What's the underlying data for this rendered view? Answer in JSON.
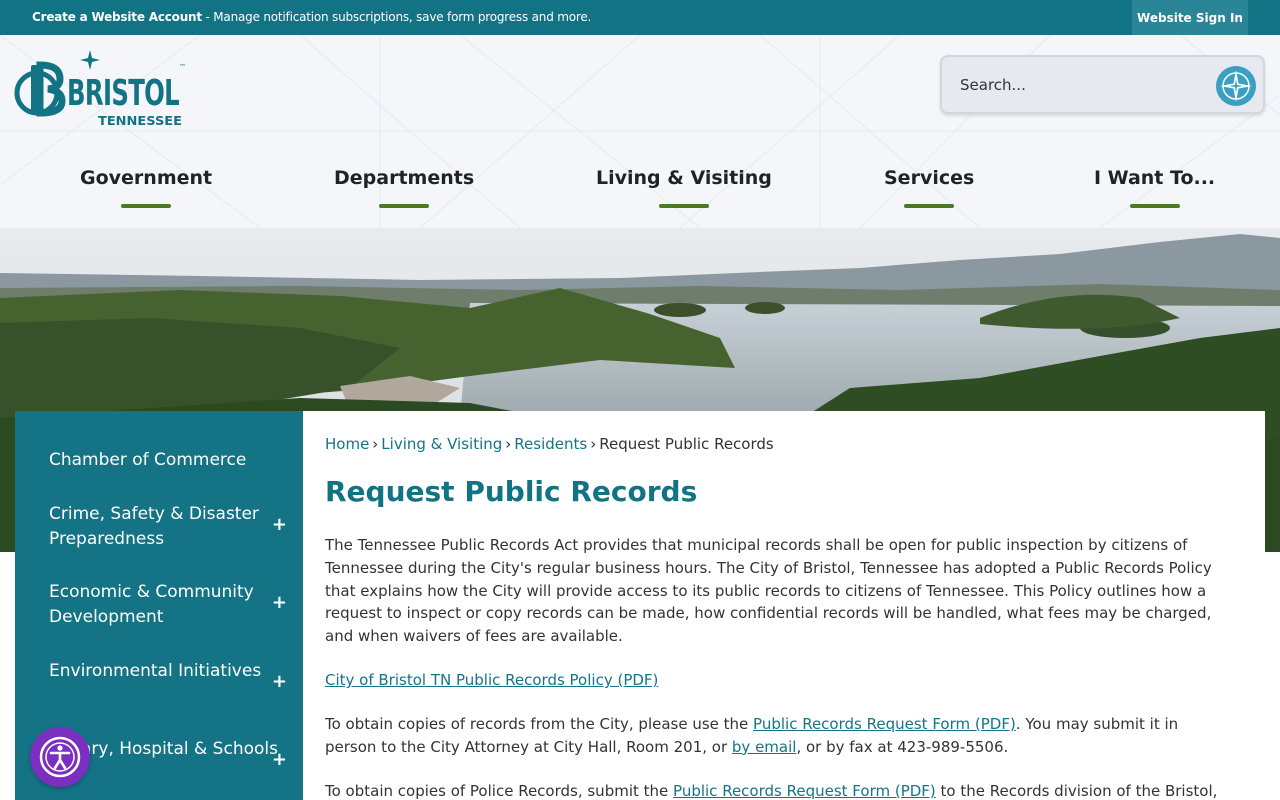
{
  "topbar": {
    "create_account": "Create a Website Account",
    "create_account_desc": " - Manage notification subscriptions, save form progress and more.",
    "sign_in": "Website Sign In"
  },
  "logo": {
    "name": "BRISTOL",
    "state": "TENNESSEE",
    "tm": "™"
  },
  "search": {
    "placeholder": "Search..."
  },
  "nav": {
    "items": [
      {
        "label": "Government"
      },
      {
        "label": "Departments"
      },
      {
        "label": "Living & Visiting"
      },
      {
        "label": "Services"
      },
      {
        "label": "I Want To..."
      }
    ]
  },
  "sidebar": {
    "items": [
      {
        "label": "Chamber of Commerce",
        "expand": ""
      },
      {
        "label": "Crime, Safety & Disaster Preparedness",
        "expand": "+"
      },
      {
        "label": "Economic & Community Development",
        "expand": "+"
      },
      {
        "label": "Environmental Initiatives",
        "expand": "+"
      },
      {
        "label": "Library, Hospital & Schools",
        "expand": "+"
      }
    ]
  },
  "breadcrumb": {
    "home": "Home",
    "living": "Living & Visiting",
    "residents": "Residents",
    "current": "Request Public Records",
    "sep": "›"
  },
  "page": {
    "title": "Request Public Records",
    "intro": "The Tennessee Public Records Act provides that municipal records shall be open for public inspection by citizens of Tennessee during the City's regular business hours. The City of Bristol, Tennessee has adopted a Public Records Policy that explains how the City will provide access to its public records to citizens of Tennessee. This Policy outlines how a request to inspect or copy records can be made, how confidential records will be handled, what fees may be charged, and when waivers of fees are available.",
    "policy_link": "City of Bristol TN Public Records Policy (PDF)",
    "p2_a": "To obtain copies of records from the City, please use the ",
    "p2_link": "Public Records Request Form (PDF)",
    "p2_b": ". You may submit it in person to the City Attorney at City Hall, Room 201, or ",
    "p2_email": "by email",
    "p2_c": ", or by fax at 423-989-5506.",
    "p3_a": "To obtain copies of Police Records, submit the ",
    "p3_link": "Public Records Request Form (PDF)",
    "p3_b": " to the Records division of the Bristol,"
  },
  "colors": {
    "teal": "#127385",
    "nav_underline": "#4b7a26",
    "accessibility": "#7b2fc1"
  }
}
